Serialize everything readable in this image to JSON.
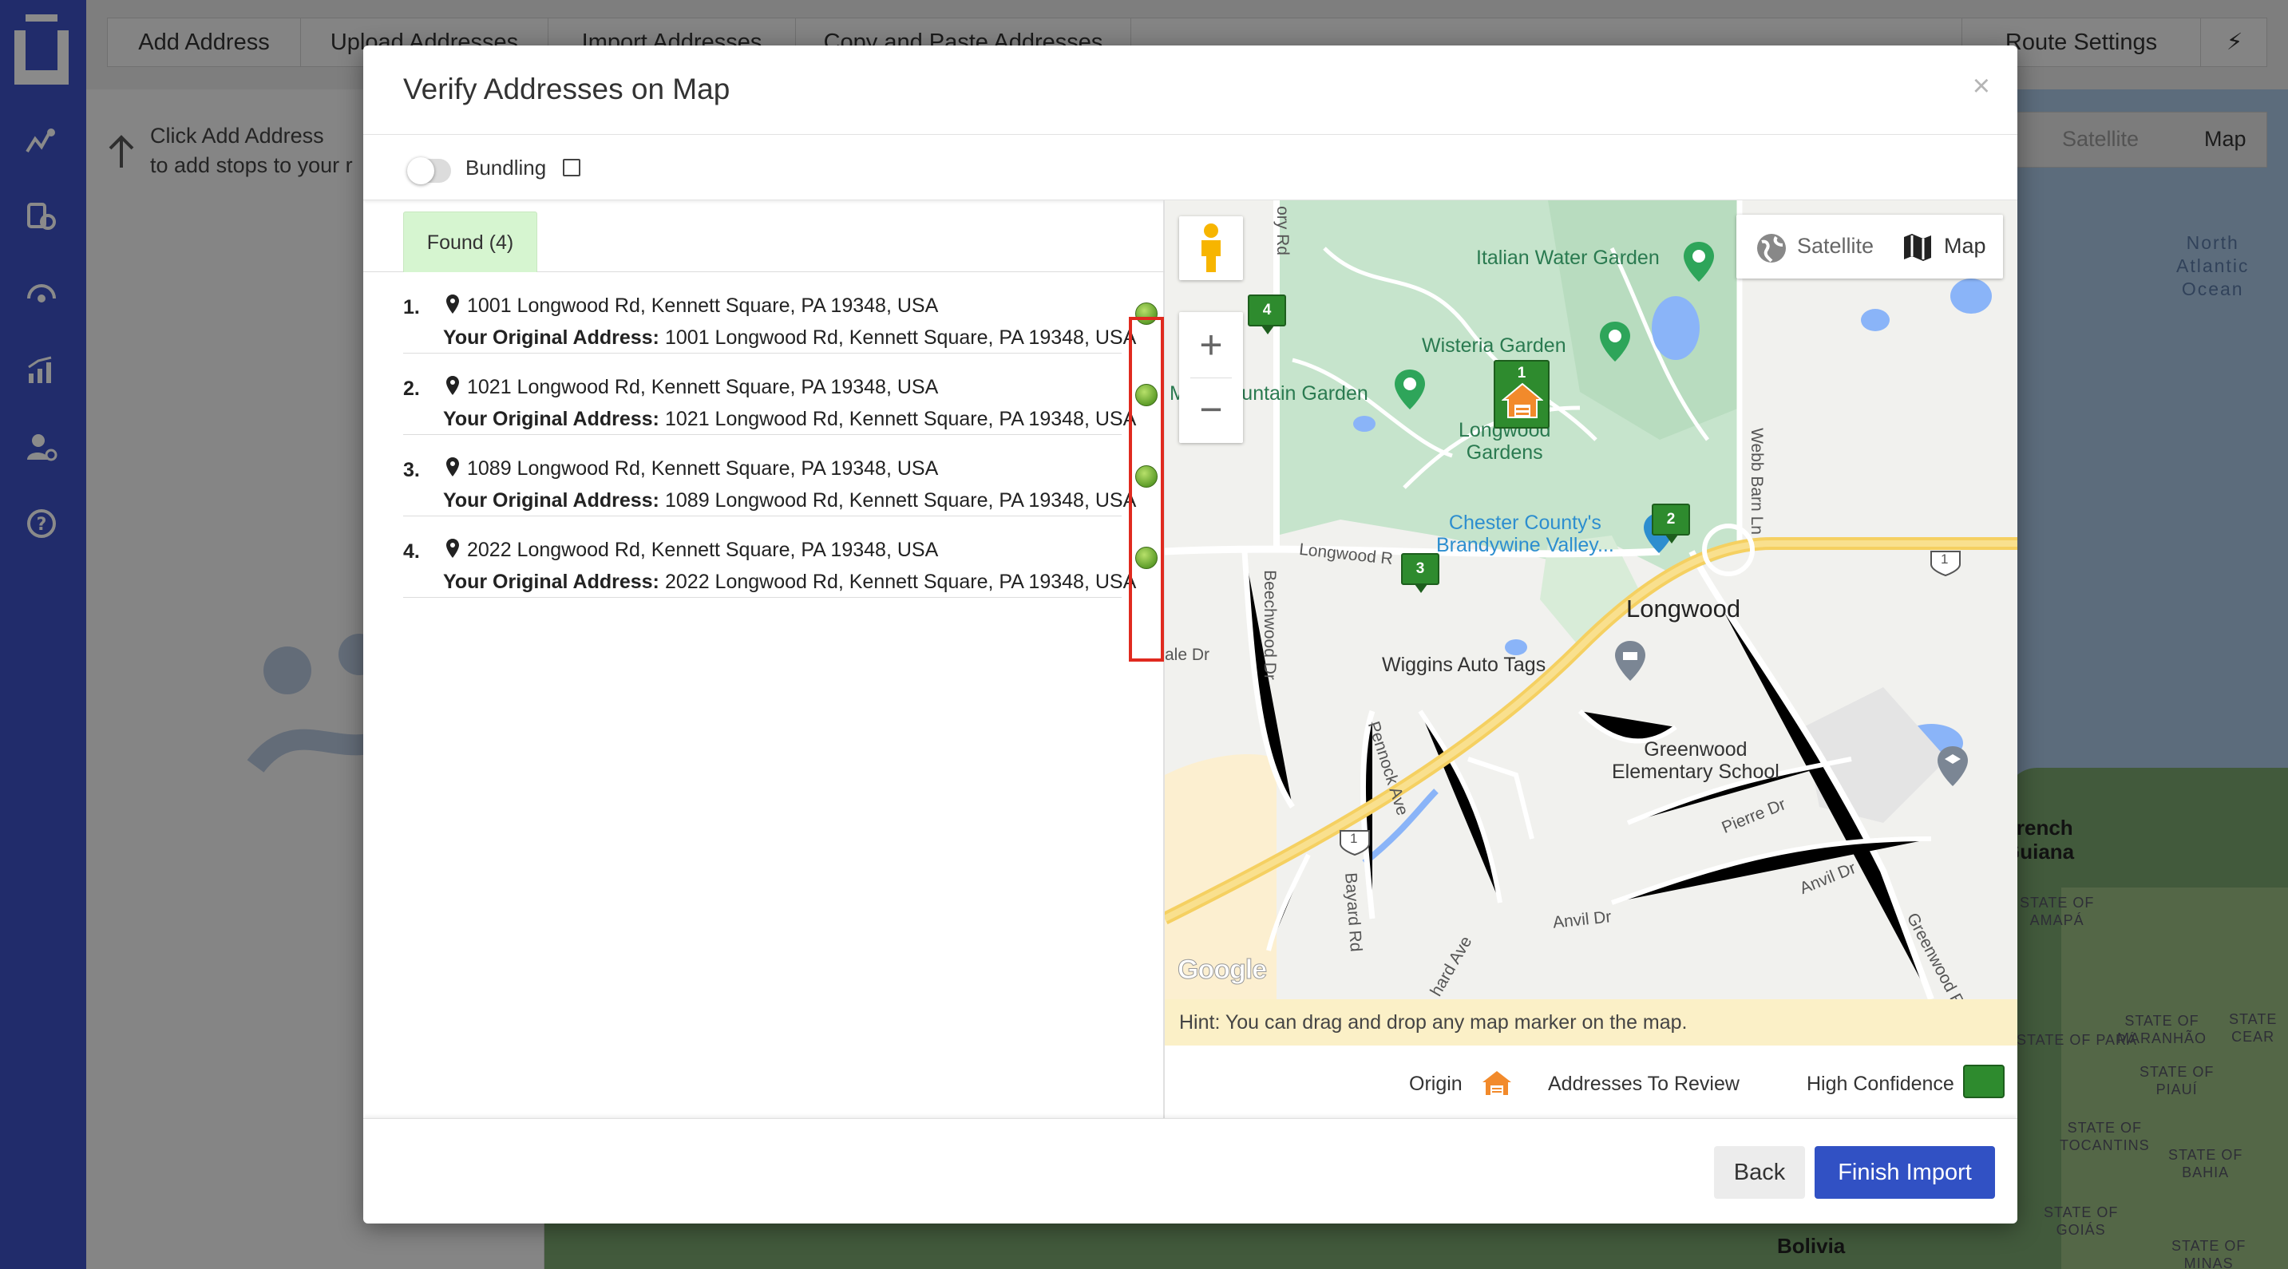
{
  "background": {
    "toolbar": {
      "tabs": [
        "Add Address",
        "Upload Addresses",
        "Import Addresses",
        "Copy and Paste Addresses"
      ],
      "route_settings": "Route Settings"
    },
    "hint_line1": "Click Add Address",
    "hint_line2": "to add stops to your r",
    "map_type": {
      "satellite": "Satellite",
      "map": "Map"
    },
    "map_labels": {
      "ocean": "North\nAtlantic\nOcean",
      "french_guiana": "French\nGuiana",
      "bolivia": "Bolivia",
      "amapa": "STATE OF\nAMAPÁ",
      "para": "STATE OF PARÁ",
      "maranhao": "STATE OF\nMARANHÃO",
      "ceara": "STATE\nCEAR",
      "piaui": "STATE OF\nPIAUÍ",
      "tocantins": "STATE OF\nTOCANTINS",
      "bahia": "STATE OF\nBAHIA",
      "goias": "STATE OF\nGOIÁS",
      "minas": "STATE OF\nMINAS"
    }
  },
  "modal": {
    "title": "Verify Addresses on Map",
    "close": "×",
    "bundling_label": "Bundling",
    "tab_found": "Found (4)",
    "original_label": "Your Original Address:",
    "addresses": [
      {
        "num": "1.",
        "address": "1001 Longwood Rd, Kennett Square, PA 19348, USA",
        "original": "1001 Longwood Rd, Kennett Square, PA 19348, USA"
      },
      {
        "num": "2.",
        "address": "1021 Longwood Rd, Kennett Square, PA 19348, USA",
        "original": "1021 Longwood Rd, Kennett Square, PA 19348, USA"
      },
      {
        "num": "3.",
        "address": "1089 Longwood Rd, Kennett Square, PA 19348, USA",
        "original": "1089 Longwood Rd, Kennett Square, PA 19348, USA"
      },
      {
        "num": "4.",
        "address": "2022 Longwood Rd, Kennett Square, PA 19348, USA",
        "original": "2022 Longwood Rd, Kennett Square, PA 19348, USA"
      }
    ],
    "map": {
      "satellite": "Satellite",
      "map": "Map",
      "labels": {
        "italian_water_garden": "Italian Water Garden",
        "wisteria_garden": "Wisteria Garden",
        "fountain_garden": "Main Fountain Garden",
        "longwood_gardens": "Longwood\nGardens",
        "chester_county": "Chester County's\nBrandywine Valley...",
        "longwood": "Longwood",
        "longwood_rd": "Longwood R",
        "wiggins": "Wiggins Auto Tags",
        "greenwood_school": "Greenwood\nElementary School",
        "beechwood_dr": "Beechwood Dr",
        "pennock_ave": "Pennock Ave",
        "bayard_rd": "Bayard Rd",
        "pierre_dr": "Pierre Dr",
        "anvil_dr1": "Anvil Dr",
        "anvil_dr2": "Anvil Dr",
        "greenwood_rd": "Greenwood R",
        "webb_barn_ln": "Webb Barn Ln",
        "hickory_rd": "ory Rd",
        "orchard_ave": "hard Ave",
        "ale_dr": "ale Dr",
        "route1a": "1",
        "route1b": "1"
      },
      "markers": [
        "1",
        "2",
        "3",
        "4"
      ],
      "google": "Google",
      "hint": "Hint: You can drag and drop any map marker on the map."
    },
    "legend": {
      "origin": "Origin",
      "review": "Addresses To Review",
      "high": "High Confidence",
      "review_color": "#f2ee2b",
      "high_color": "#2e8b2e",
      "origin_color": "#f28a2b"
    },
    "buttons": {
      "back": "Back",
      "finish": "Finish Import"
    }
  },
  "colors": {
    "accent": "#3151c4",
    "sidebar": "#3d52c6",
    "highlight": "#e02a1f"
  }
}
